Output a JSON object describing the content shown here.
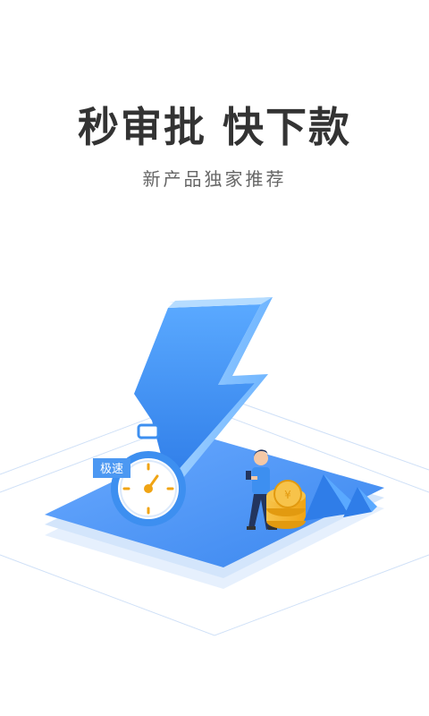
{
  "headline": "秒审批 快下款",
  "subtitle": "新产品独家推荐",
  "badge": "极速",
  "colors": {
    "headline": "#333333",
    "subtitle": "#666666",
    "accent_blue": "#3d8ff0",
    "coin_gold": "#f6b92d"
  },
  "icons": [
    "lightning-bolt-icon",
    "stopwatch-icon",
    "coin-stack-icon",
    "pyramid-icon"
  ]
}
